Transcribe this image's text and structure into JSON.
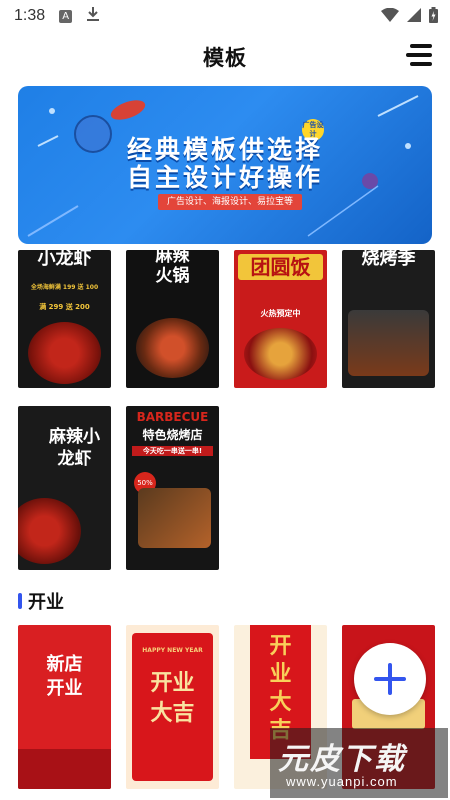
{
  "status": {
    "time": "1:38",
    "a_icon": "A"
  },
  "header": {
    "title": "模板",
    "menu_icon": "menu-icon"
  },
  "banner": {
    "title_line1": "经典模板供选择",
    "title_line2": "自主设计好操作",
    "subtitle": "广告设计、海报设计、易拉宝等",
    "badge": "广告设计"
  },
  "cards_row1": [
    {
      "label": "小龙虾",
      "sub": "全场海鲜满 199 送 100",
      "sub2": "满 299 送 200"
    },
    {
      "label": "麻辣火锅"
    },
    {
      "label": "团圆饭",
      "sub": "火热预定中"
    },
    {
      "label": "烧烤季"
    }
  ],
  "cards_row2": [
    {
      "label": "麻辣小龙虾"
    },
    {
      "label": "BARBECUE",
      "sub": "特色烧烤店",
      "sub2": "今天吃一串送一串!",
      "badge": "50%"
    }
  ],
  "section": {
    "title": "开业"
  },
  "cards_row3": [
    {
      "label": "新店开业"
    },
    {
      "label": "开业大吉",
      "top": "HAPPY NEW YEAR"
    },
    {
      "label": "开业大吉"
    },
    {
      "label": ""
    }
  ],
  "watermark": {
    "text": "元皮下载",
    "url": "www.yuanpi.com"
  },
  "colors": {
    "accent": "#3355ee",
    "banner": "#2d8cf0",
    "red": "#d8161b"
  }
}
